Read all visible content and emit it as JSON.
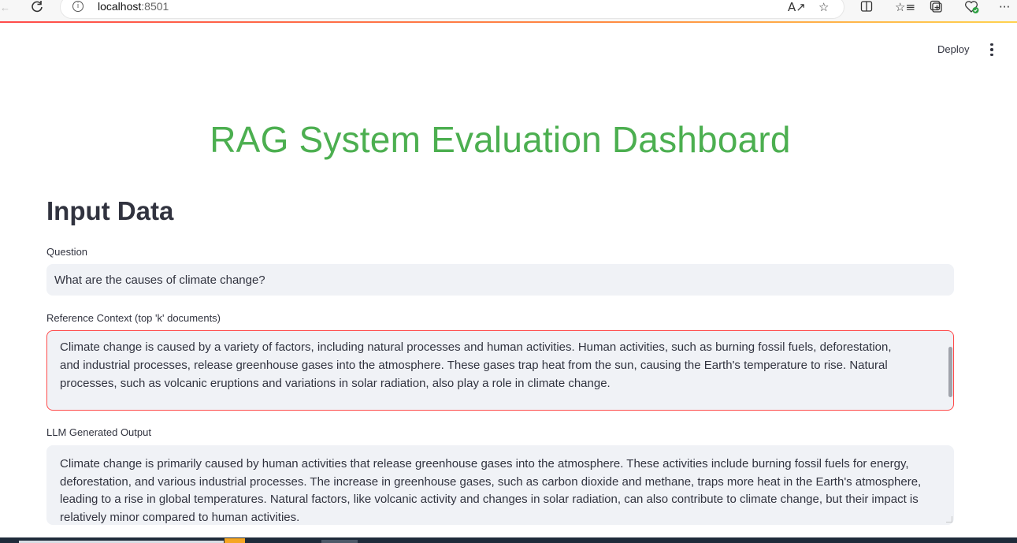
{
  "browser": {
    "url_host": "localhost",
    "url_port": ":8501",
    "icons": {
      "back": "back-arrow-icon",
      "refresh": "refresh-icon",
      "info": "info-icon",
      "read_aloud": "read-aloud-icon",
      "favorite": "star-icon",
      "split": "split-screen-icon",
      "favorites": "favorites-list-icon",
      "collections": "collections-icon",
      "health": "browser-essentials-icon",
      "more": "more-icon"
    }
  },
  "header": {
    "deploy_label": "Deploy",
    "menu_icon": "kebab-menu-icon"
  },
  "main": {
    "title": "RAG System Evaluation Dashboard",
    "section_heading": "Input Data",
    "question": {
      "label": "Question",
      "value": "What are the causes of climate change?"
    },
    "reference_context": {
      "label": "Reference Context (top 'k' documents)",
      "value": "Climate change is caused by a variety of factors, including natural processes and human activities. Human activities, such as burning fossil fuels, deforestation, and industrial processes, release greenhouse gases into the atmosphere. These gases trap heat from the sun, causing the Earth's temperature to rise. Natural processes, such as volcanic eruptions and variations in solar radiation, also play a role in climate change."
    },
    "llm_output": {
      "label": "LLM Generated Output",
      "value": "Climate change is primarily caused by human activities that release greenhouse gases into the atmosphere. These activities include burning fossil fuels for energy, deforestation, and various industrial processes. The increase in greenhouse gases, such as carbon dioxide and methane, traps more heat in the Earth's atmosphere, leading to a rise in global temperatures. Natural factors, like volcanic activity and changes in solar radiation, can also contribute to climate change, but their impact is relatively minor compared to human activities."
    }
  },
  "colors": {
    "title_green": "#4caf50",
    "focus_red": "#ff4b4b",
    "input_bg": "#f0f2f6",
    "text": "#31333f"
  }
}
